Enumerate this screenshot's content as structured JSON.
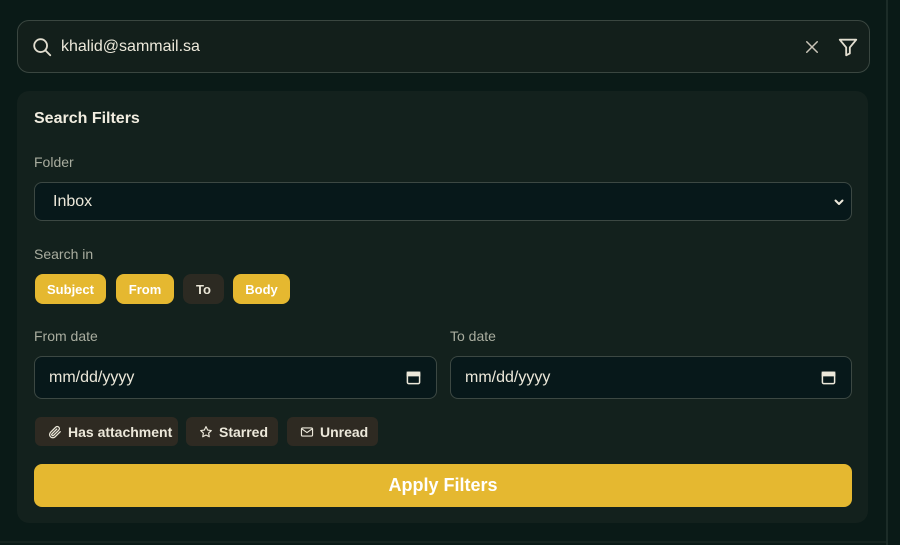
{
  "search": {
    "value": "khalid@sammail.sa",
    "icon": "search-icon",
    "clear_icon": "close-icon",
    "filter_icon": "filter-icon"
  },
  "filters": {
    "title": "Search Filters",
    "folder": {
      "label": "Folder",
      "selected": "Inbox"
    },
    "search_in": {
      "label": "Search in",
      "options": [
        {
          "label": "Subject",
          "active": true
        },
        {
          "label": "From",
          "active": true
        },
        {
          "label": "To",
          "active": false
        },
        {
          "label": "Body",
          "active": true
        }
      ]
    },
    "from_date": {
      "label": "From date",
      "placeholder": "mm/dd/yyyy"
    },
    "to_date": {
      "label": "To date",
      "placeholder": "mm/dd/yyyy"
    },
    "toggles": [
      {
        "label": "Has attachment",
        "icon": "paperclip-icon"
      },
      {
        "label": "Starred",
        "icon": "star-icon"
      },
      {
        "label": "Unread",
        "icon": "mail-icon"
      }
    ],
    "apply_label": "Apply Filters"
  },
  "colors": {
    "accent": "#e5b830",
    "background": "#0a1a17",
    "panel": "#13211d",
    "chip_inactive": "#2c2a22"
  }
}
